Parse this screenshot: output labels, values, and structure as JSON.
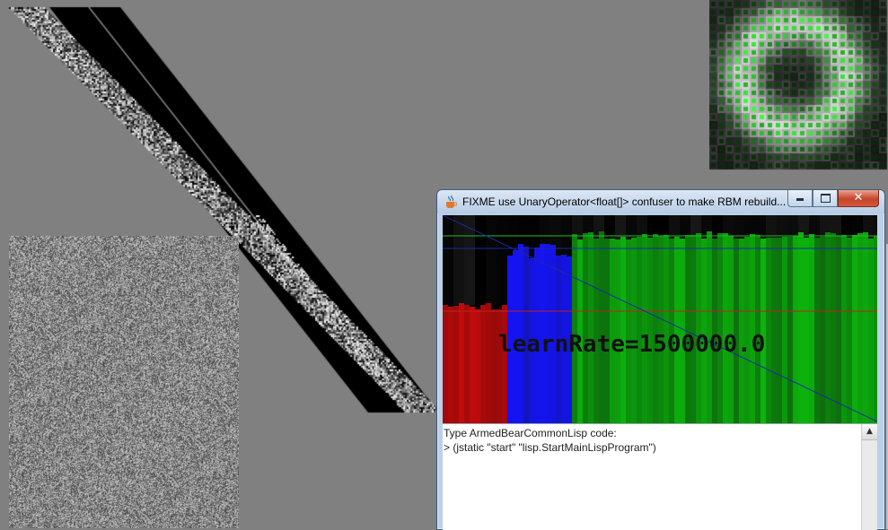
{
  "window": {
    "title": "FIXME use UnaryOperator<float[]> confuser to make RBM rebuild...",
    "buttons": {
      "minimize": "minimize",
      "maximize": "maximize",
      "close": "✕"
    }
  },
  "chart": {
    "label": "learnRate=1500000.0"
  },
  "console": {
    "prompt_header": "Type ArmedBearCommonLisp code:",
    "last_command": "> (jstatic \"start\" \"lisp.StartMainLispProgram\")"
  },
  "colors": {
    "desktop": "#808080",
    "red_series": "#d81414",
    "blue_series": "#2020e0",
    "green_series": "#16a016",
    "bright_green": "#1cf01c",
    "line_blue": "#1a2aa8",
    "line_green": "#1fbf1f",
    "line_red": "#c02020"
  }
}
